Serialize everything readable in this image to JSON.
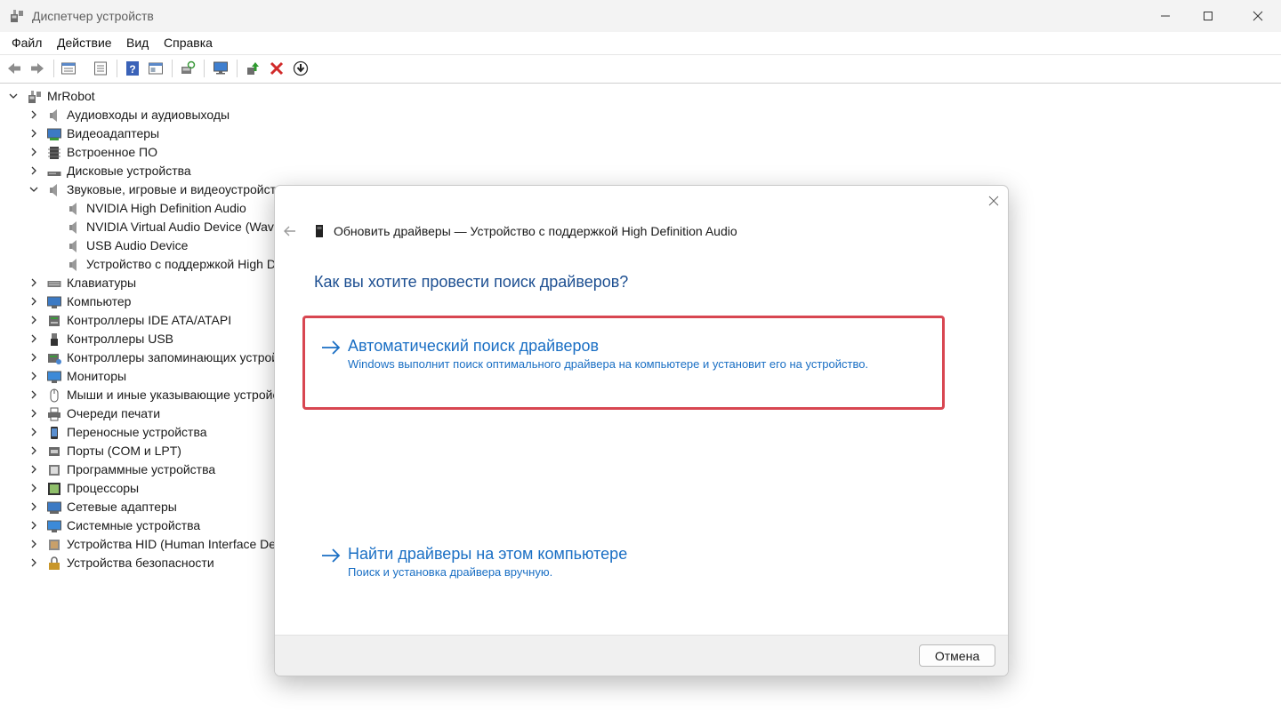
{
  "window": {
    "title": "Диспетчер устройств"
  },
  "menu": [
    "Файл",
    "Действие",
    "Вид",
    "Справка"
  ],
  "toolbar": {
    "icons": [
      "back-icon",
      "forward-icon",
      "properties-grid-icon",
      "view-list-icon",
      "help-icon",
      "view-panel-icon",
      "scan-hardware-icon",
      "monitor-icon",
      "update-driver-icon",
      "remove-device-icon",
      "download-driver-icon"
    ]
  },
  "tree": {
    "root": "MrRobot",
    "items": [
      {
        "label": "Аудиовходы и аудиовыходы",
        "icon": "speaker-icon"
      },
      {
        "label": "Видеоадаптеры",
        "icon": "display-adapter-icon"
      },
      {
        "label": "Встроенное ПО",
        "icon": "firmware-icon"
      },
      {
        "label": "Дисковые устройства",
        "icon": "disk-icon"
      },
      {
        "label": "Звуковые, игровые и видеоустройства",
        "icon": "speaker-icon",
        "expanded": true,
        "children": [
          "NVIDIA High Definition Audio",
          "NVIDIA Virtual Audio Device (Wave Extensible) (WDM)",
          "USB Audio Device",
          "Устройство с поддержкой High Definition Audio"
        ]
      },
      {
        "label": "Клавиатуры",
        "icon": "keyboard-icon"
      },
      {
        "label": "Компьютер",
        "icon": "computer-icon"
      },
      {
        "label": "Контроллеры IDE ATA/ATAPI",
        "icon": "ide-controller-icon"
      },
      {
        "label": "Контроллеры USB",
        "icon": "usb-icon"
      },
      {
        "label": "Контроллеры запоминающих устройств",
        "icon": "storage-controller-icon"
      },
      {
        "label": "Мониторы",
        "icon": "monitor-icon"
      },
      {
        "label": "Мыши и иные указывающие устройства",
        "icon": "mouse-icon"
      },
      {
        "label": "Очереди печати",
        "icon": "printer-icon"
      },
      {
        "label": "Переносные устройства",
        "icon": "portable-device-icon"
      },
      {
        "label": "Порты (COM и LPT)",
        "icon": "port-icon"
      },
      {
        "label": "Программные устройства",
        "icon": "software-device-icon"
      },
      {
        "label": "Процессоры",
        "icon": "processor-icon"
      },
      {
        "label": "Сетевые адаптеры",
        "icon": "network-adapter-icon"
      },
      {
        "label": "Системные устройства",
        "icon": "system-device-icon"
      },
      {
        "label": "Устройства HID (Human Interface Devices)",
        "icon": "hid-icon"
      },
      {
        "label": "Устройства безопасности",
        "icon": "security-device-icon"
      }
    ]
  },
  "dialog": {
    "header": "Обновить драйверы — Устройство с поддержкой High Definition Audio",
    "question": "Как вы хотите провести поиск драйверов?",
    "option_auto": {
      "title": "Автоматический поиск драйверов",
      "description": "Windows выполнит поиск оптимального драйвера на компьютере и установит его на устройство."
    },
    "option_manual": {
      "title": "Найти драйверы на этом компьютере",
      "description": "Поиск и установка драйвера вручную."
    },
    "cancel_label": "Отмена",
    "highlight_color": "#d84651",
    "link_color": "#1a6fc4"
  }
}
